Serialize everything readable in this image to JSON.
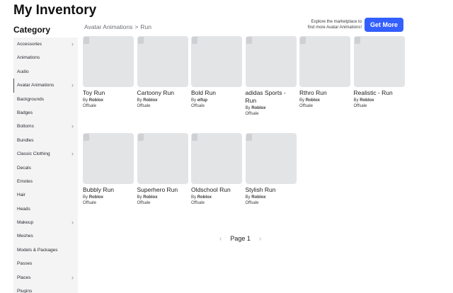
{
  "header": {
    "title": "My Inventory"
  },
  "sidebar": {
    "heading": "Category",
    "items": [
      {
        "label": "Accessories",
        "chevron": true,
        "active": false
      },
      {
        "label": "Animations",
        "chevron": false,
        "active": false
      },
      {
        "label": "Audio",
        "chevron": false,
        "active": false
      },
      {
        "label": "Avatar Animations",
        "chevron": true,
        "active": true
      },
      {
        "label": "Backgrounds",
        "chevron": false,
        "active": false
      },
      {
        "label": "Badges",
        "chevron": false,
        "active": false
      },
      {
        "label": "Bottoms",
        "chevron": true,
        "active": false
      },
      {
        "label": "Bundles",
        "chevron": false,
        "active": false
      },
      {
        "label": "Classic Clothing",
        "chevron": true,
        "active": false
      },
      {
        "label": "Decals",
        "chevron": false,
        "active": false
      },
      {
        "label": "Emotes",
        "chevron": false,
        "active": false
      },
      {
        "label": "Hair",
        "chevron": false,
        "active": false
      },
      {
        "label": "Heads",
        "chevron": false,
        "active": false
      },
      {
        "label": "Makeup",
        "chevron": true,
        "active": false
      },
      {
        "label": "Meshes",
        "chevron": false,
        "active": false
      },
      {
        "label": "Models & Packages",
        "chevron": false,
        "active": false
      },
      {
        "label": "Passes",
        "chevron": false,
        "active": false
      },
      {
        "label": "Places",
        "chevron": true,
        "active": false
      },
      {
        "label": "Plugins",
        "chevron": false,
        "active": false
      }
    ]
  },
  "breadcrumb": {
    "parent": "Avatar Animations",
    "separator": ">",
    "current": "Run"
  },
  "promo": {
    "line1": "Explore the marketplace to",
    "line2": "find more Avatar Animations!",
    "button": "Get More"
  },
  "items": [
    {
      "name": "Toy Run",
      "by": "By",
      "creator": "Roblox",
      "price": "Offsale"
    },
    {
      "name": "Cartoony Run",
      "by": "By",
      "creator": "Roblox",
      "price": "Offsale"
    },
    {
      "name": "Bold Run",
      "by": "By",
      "creator": "elfup",
      "price": "Offsale"
    },
    {
      "name": "adidas Sports - Run",
      "by": "By",
      "creator": "Roblox",
      "price": "Offsale"
    },
    {
      "name": "Rthro Run",
      "by": "By",
      "creator": "Roblox",
      "price": "Offsale"
    },
    {
      "name": "Realistic - Run",
      "by": "By",
      "creator": "Roblox",
      "price": "Offsale"
    },
    {
      "name": "Bubbly Run",
      "by": "By",
      "creator": "Roblox",
      "price": "Offsale"
    },
    {
      "name": "Superhero Run",
      "by": "By",
      "creator": "Roblox",
      "price": "Offsale"
    },
    {
      "name": "Oldschool Run",
      "by": "By",
      "creator": "Roblox",
      "price": "Offsale"
    },
    {
      "name": "Stylish Run",
      "by": "By",
      "creator": "Roblox",
      "price": "Offsale"
    }
  ],
  "pagination": {
    "label": "Page 1",
    "prev_icon": "chevron-left-icon",
    "next_icon": "chevron-right-icon"
  },
  "colors": {
    "accent": "#335fff",
    "sidebar_bg": "#f4f4f5",
    "thumb_bg": "#e3e4e6"
  }
}
